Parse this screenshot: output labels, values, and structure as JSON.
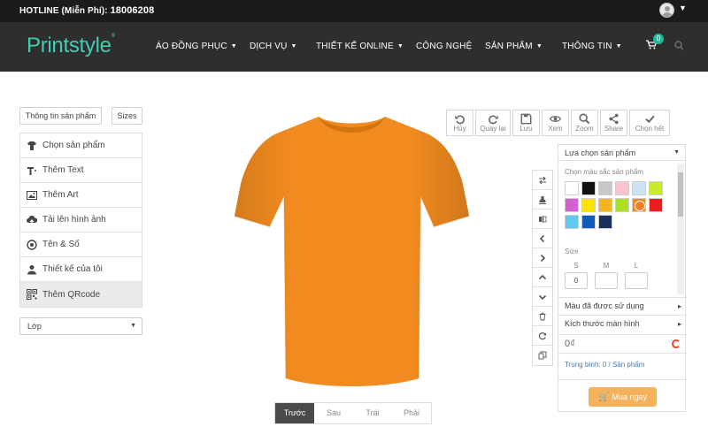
{
  "topbar": {
    "hotline_label": "HOTLINE (Miễn Phí):",
    "hotline_number": "18006208"
  },
  "navbar": {
    "logo": "Printstyle",
    "items": [
      {
        "label": "ÁO ĐỒNG PHỤC",
        "has_caret": true
      },
      {
        "label": "DỊCH VỤ",
        "has_caret": true
      },
      {
        "label": "THIẾT KẾ ONLINE",
        "has_caret": true
      },
      {
        "label": "CÔNG NGHỆ",
        "has_caret": false
      },
      {
        "label": "SẢN PHẨM",
        "has_caret": true
      },
      {
        "label": "THÔNG TIN",
        "has_caret": true
      }
    ],
    "cart_count": "0"
  },
  "left": {
    "tab_product_info": "Thông tin sản phẩm",
    "tab_sizes": "Sizes",
    "menu": [
      {
        "label": "Chọn sản phẩm",
        "icon": "tshirt-icon"
      },
      {
        "label": "Thêm Text",
        "icon": "text-icon"
      },
      {
        "label": "Thêm Art",
        "icon": "image-icon"
      },
      {
        "label": "Tải lên hình ảnh",
        "icon": "upload-icon"
      },
      {
        "label": "Tên & Số",
        "icon": "target-icon"
      },
      {
        "label": "Thiết kế của tôi",
        "icon": "user-icon"
      },
      {
        "label": "Thêm QRcode",
        "icon": "qrcode-icon"
      }
    ],
    "layer_select": "Lớp"
  },
  "canvas": {
    "shirt_color": "#f28b1f",
    "views": [
      "Trước",
      "Sau",
      "Trái",
      "Phải"
    ],
    "active_view": "Trước"
  },
  "toolbar": [
    {
      "label": "Hủy",
      "icon": "undo-icon"
    },
    {
      "label": "Quay lại",
      "icon": "redo-icon"
    },
    {
      "label": "Lưu",
      "icon": "save-icon"
    },
    {
      "label": "Xem",
      "icon": "eye-icon"
    },
    {
      "label": "Zoom",
      "icon": "zoom-icon"
    },
    {
      "label": "Share",
      "icon": "share-icon"
    },
    {
      "label": "Chọn hết",
      "icon": "check-icon"
    }
  ],
  "side_tools": [
    "swap-icon",
    "stamp-icon",
    "flip-icon",
    "arrow-left-icon",
    "arrow-right-icon",
    "arrow-up-icon",
    "arrow-down-icon",
    "trash-icon",
    "refresh-icon",
    "copy-icon"
  ],
  "panel": {
    "header": "Lựa chọn sản phẩm",
    "color_label": "Chọn màu sắc sản phẩm",
    "colors": [
      "#ffffff",
      "#111111",
      "#c8c8c8",
      "#f7c4d0",
      "#c9e4f6",
      "#c7ec2a",
      "#d85ed6",
      "#ffe400",
      "#f5b51c",
      "#ade024",
      "#f28b1f",
      "#ea1c1c",
      "#62c8ef",
      "#0e5bb8",
      "#1b2f5c"
    ],
    "selected_color": "#f28b1f",
    "size_label": "Size",
    "sizes": [
      {
        "label": "S",
        "value": "0"
      },
      {
        "label": "M",
        "value": ""
      },
      {
        "label": "L",
        "value": ""
      }
    ],
    "used_colors": "Màu đã được sử dụng",
    "screen_size": "Kích thước màn hình",
    "price": "0₫",
    "average": "Trung bình: 0 / Sản phẩm",
    "buy_button": "Mua ngay"
  }
}
